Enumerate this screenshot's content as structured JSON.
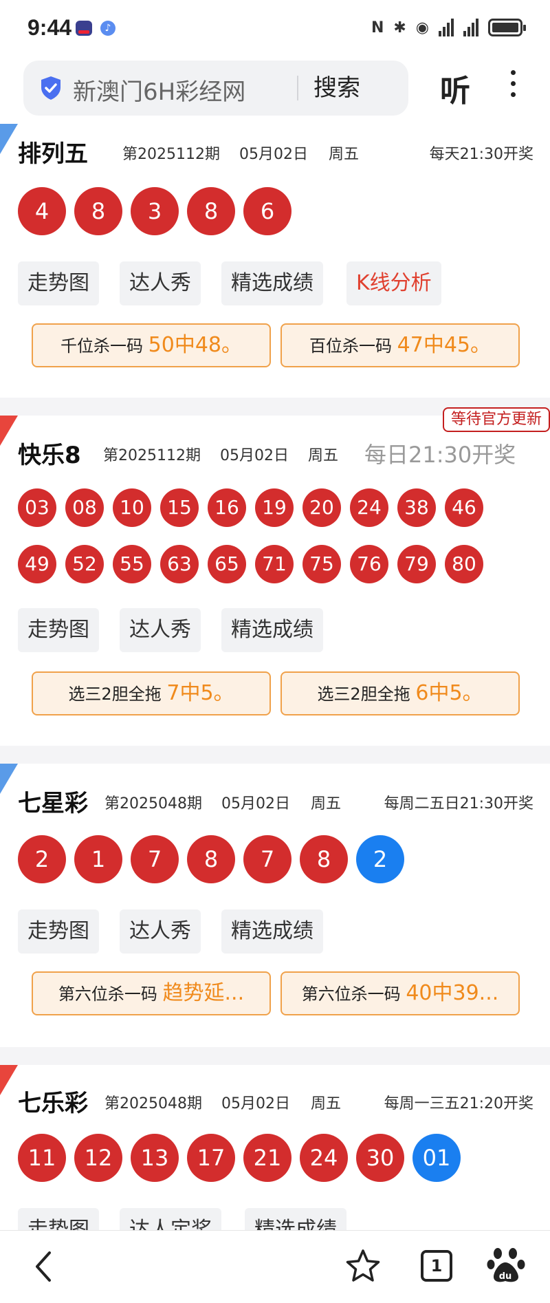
{
  "status_bar": {
    "time": "9:44",
    "nfc_label": "N",
    "bluetooth_label": "✱",
    "wifi_label": "◉"
  },
  "search": {
    "text": "新澳门6H彩经网",
    "search_button": "搜索",
    "listen_button": "听"
  },
  "lotteries": [
    {
      "name": "排列五",
      "period": "第2025112期",
      "date": "05月02日",
      "weekday": "周五",
      "draw_time": "每天21:30开奖",
      "balls": [
        "4",
        "8",
        "3",
        "8",
        "6"
      ],
      "actions": [
        "走势图",
        "达人秀",
        "精选成绩",
        "K线分析"
      ],
      "stats": [
        {
          "label": "千位杀一码",
          "value": "50中48。"
        },
        {
          "label": "百位杀一码",
          "value": "47中45。"
        }
      ]
    },
    {
      "name": "快乐8",
      "period": "第2025112期",
      "date": "05月02日",
      "weekday": "周五",
      "draw_time": "每日21:30开奖",
      "badge": "等待官方更新",
      "balls_row1": [
        "03",
        "08",
        "10",
        "15",
        "16",
        "19",
        "20",
        "24",
        "38",
        "46"
      ],
      "balls_row2": [
        "49",
        "52",
        "55",
        "63",
        "65",
        "71",
        "75",
        "76",
        "79",
        "80"
      ],
      "actions": [
        "走势图",
        "达人秀",
        "精选成绩"
      ],
      "stats": [
        {
          "label": "选三2胆全拖",
          "value": "7中5。"
        },
        {
          "label": "选三2胆全拖",
          "value": "6中5。"
        }
      ]
    },
    {
      "name": "七星彩",
      "period": "第2025048期",
      "date": "05月02日",
      "weekday": "周五",
      "draw_time": "每周二五日21:30开奖",
      "balls": [
        "2",
        "1",
        "7",
        "8",
        "7",
        "8"
      ],
      "blue_ball": "2",
      "actions": [
        "走势图",
        "达人秀",
        "精选成绩"
      ],
      "stats": [
        {
          "label": "第六位杀一码",
          "value": "趋势延..."
        },
        {
          "label": "第六位杀一码",
          "value": "40中39..."
        }
      ]
    },
    {
      "name": "七乐彩",
      "period": "第2025048期",
      "date": "05月02日",
      "weekday": "周五",
      "draw_time": "每周一三五21:20开奖",
      "balls": [
        "11",
        "12",
        "13",
        "17",
        "21",
        "24",
        "30"
      ],
      "blue_ball": "01",
      "actions": [
        "走势图",
        "达人定奖",
        "精选成绩"
      ]
    }
  ],
  "bottom_nav": {
    "tab_count": "1"
  },
  "colors": {
    "red_ball": "#d32d2d",
    "blue_ball": "#1a7ff0",
    "stat_border": "#f0a14a",
    "stat_highlight": "#f08a1c",
    "badge_red": "#c41f1f"
  }
}
